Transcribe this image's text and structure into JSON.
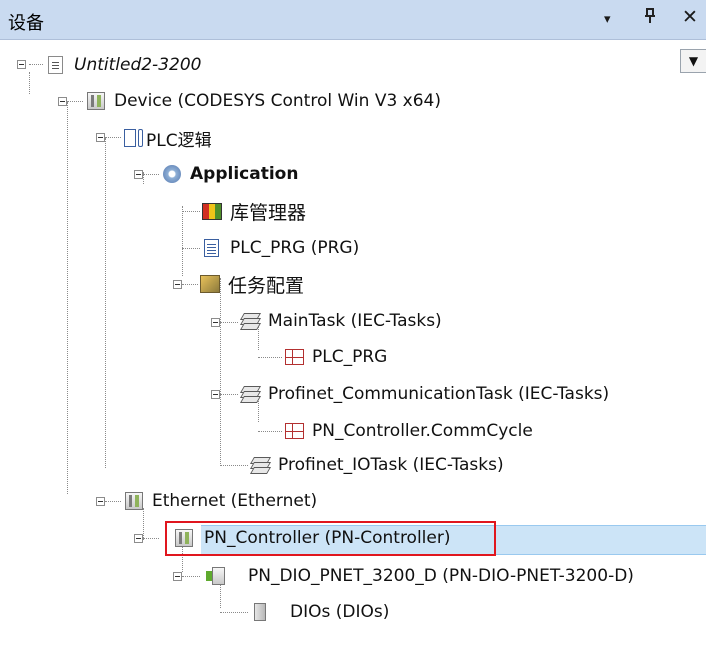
{
  "panel": {
    "title": "设备",
    "dropdown_glyph": "▾",
    "pin_glyph": "ㅁ",
    "close_glyph": "✕",
    "combo_glyph": "▼"
  },
  "tree": {
    "project": "Untitled2-3200",
    "device": "Device (CODESYS Control Win V3 x64)",
    "plc_logic": "PLC逻辑",
    "application": "Application",
    "library_manager": "库管理器",
    "plc_prg": "PLC_PRG (PRG)",
    "task_config": "任务配置",
    "main_task": "MainTask (IEC-Tasks)",
    "main_task_prg": "PLC_PRG",
    "profinet_comm_task": "Profinet_CommunicationTask (IEC-Tasks)",
    "comm_cycle": "PN_Controller.CommCycle",
    "profinet_io_task": "Profinet_IOTask (IEC-Tasks)",
    "ethernet": "Ethernet (Ethernet)",
    "pn_controller": "PN_Controller (PN-Controller)",
    "pn_dio": "PN_DIO_PNET_3200_D (PN-DIO-PNET-3200-D)",
    "dios": "DIOs (DIOs)"
  },
  "icons": {
    "project": "project-file-icon",
    "device": "device-icon",
    "plc_logic": "plc-logic-icon",
    "application": "application-gear-icon",
    "library_manager": "library-books-icon",
    "pou": "pou-document-icon",
    "task_config": "task-configuration-icon",
    "task": "task-stack-icon",
    "program_call": "program-call-icon",
    "pn_device": "profinet-device-icon",
    "module": "io-module-icon"
  },
  "colors": {
    "titlebar": "#c9daf0",
    "selection": "#cce4f7",
    "highlight_border": "#e0161e"
  }
}
